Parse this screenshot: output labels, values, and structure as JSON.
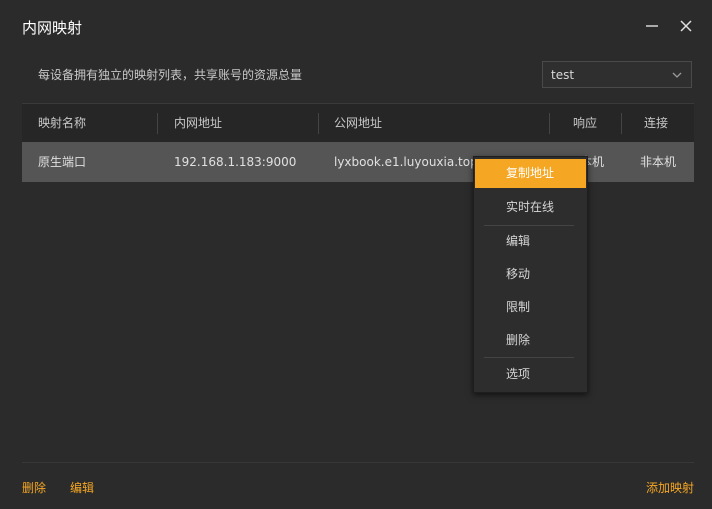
{
  "window": {
    "title": "内网映射"
  },
  "header": {
    "description": "每设备拥有独立的映射列表，共享账号的资源总量",
    "select_value": "test"
  },
  "table": {
    "columns": [
      "映射名称",
      "内网地址",
      "公网地址",
      "响应",
      "连接"
    ],
    "rows": [
      {
        "name": "原生端口",
        "internal": "192.168.1.183:9000",
        "public": "lyxbook.e1.luyouxia.top",
        "response": "本机",
        "connection": "非本机"
      }
    ]
  },
  "context_menu": {
    "items": [
      "复制地址",
      "实时在线",
      "编辑",
      "移动",
      "限制",
      "删除",
      "选项"
    ],
    "active_index": 0
  },
  "footer": {
    "delete_label": "删除",
    "edit_label": "编辑",
    "add_label": "添加映射"
  },
  "colors": {
    "accent": "#f5a623",
    "background": "#2b2b2b",
    "row_selected": "#555555"
  }
}
